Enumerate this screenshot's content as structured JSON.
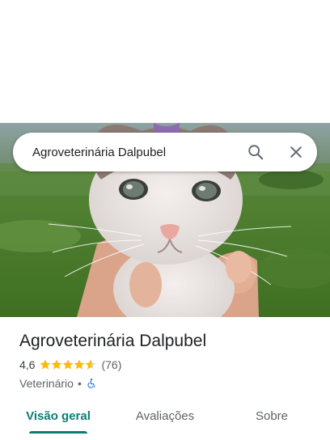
{
  "search": {
    "query": "Agroveterinária Dalpubel"
  },
  "place": {
    "name": "Agroveterinária Dalpubel",
    "rating": "4,6",
    "stars_filled": 4.6,
    "review_count": "(76)",
    "category": "Veterinário",
    "separator": "•"
  },
  "tabs": [
    {
      "label": "Visão geral",
      "active": true
    },
    {
      "label": "Avaliações",
      "active": false
    },
    {
      "label": "Sobre",
      "active": false
    }
  ],
  "icons": {
    "search": "search-icon",
    "close": "close-icon",
    "accessibility": "wheelchair-icon",
    "star": "star-icon"
  },
  "colors": {
    "accent": "#0b7c74",
    "star": "#fbbc04",
    "accessibility": "#1a73e8"
  }
}
